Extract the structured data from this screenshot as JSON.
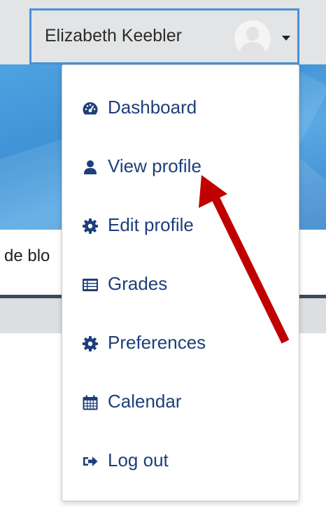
{
  "user": {
    "name": "Elizabeth Keebler"
  },
  "page": {
    "side_text": "de blo"
  },
  "menu": {
    "items": [
      {
        "label": "Dashboard",
        "icon": "dashboard-icon"
      },
      {
        "label": "View profile",
        "icon": "user-icon"
      },
      {
        "label": "Edit profile",
        "icon": "gear-icon"
      },
      {
        "label": "Grades",
        "icon": "table-icon"
      },
      {
        "label": "Preferences",
        "icon": "gear-icon"
      },
      {
        "label": "Calendar",
        "icon": "calendar-icon"
      },
      {
        "label": "Log out",
        "icon": "sign-out-icon"
      }
    ]
  },
  "colors": {
    "menu_text": "#1d3f7a",
    "toggle_border": "#4a90d9",
    "annotation_arrow": "#c00000",
    "banner": "#4fa3e1"
  }
}
